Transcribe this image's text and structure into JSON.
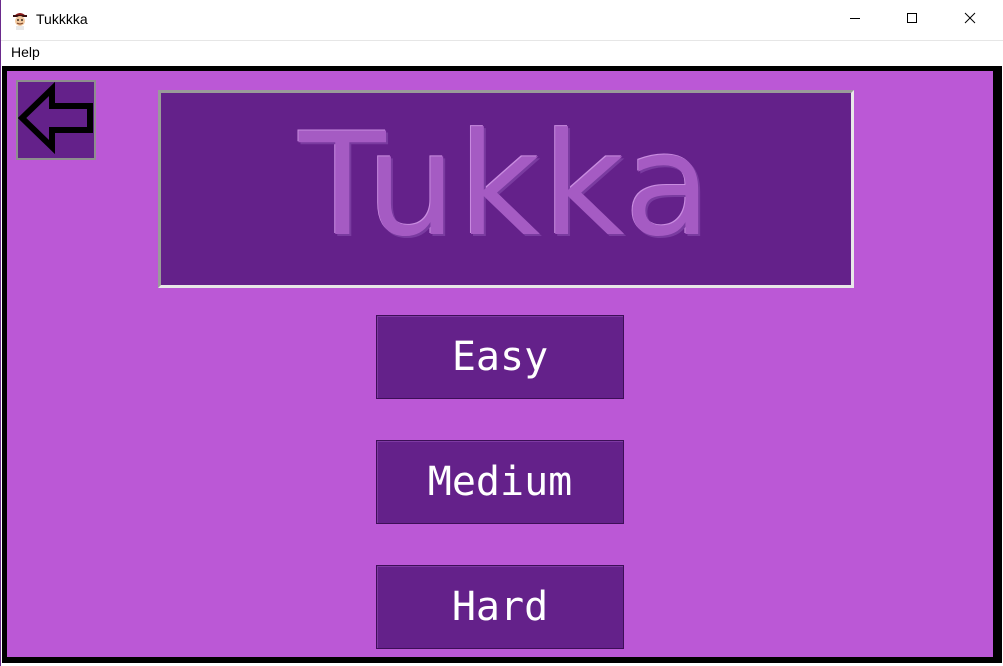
{
  "window": {
    "title": "Tukkkka",
    "app_icon": "pirate-face-icon",
    "controls": [
      "minimize-icon",
      "maximize-icon",
      "close-icon"
    ]
  },
  "menu": {
    "items": [
      {
        "label": "Help"
      }
    ]
  },
  "game": {
    "logo_text": "Tukka",
    "back_button_icon": "arrow-left-icon",
    "level_buttons": [
      {
        "label": "Easy"
      },
      {
        "label": "Medium"
      },
      {
        "label": "Hard"
      }
    ]
  },
  "colors": {
    "background": "#bb58d6",
    "button_fill": "#64218a",
    "frame": "#000000",
    "button_text": "#ffffff"
  }
}
